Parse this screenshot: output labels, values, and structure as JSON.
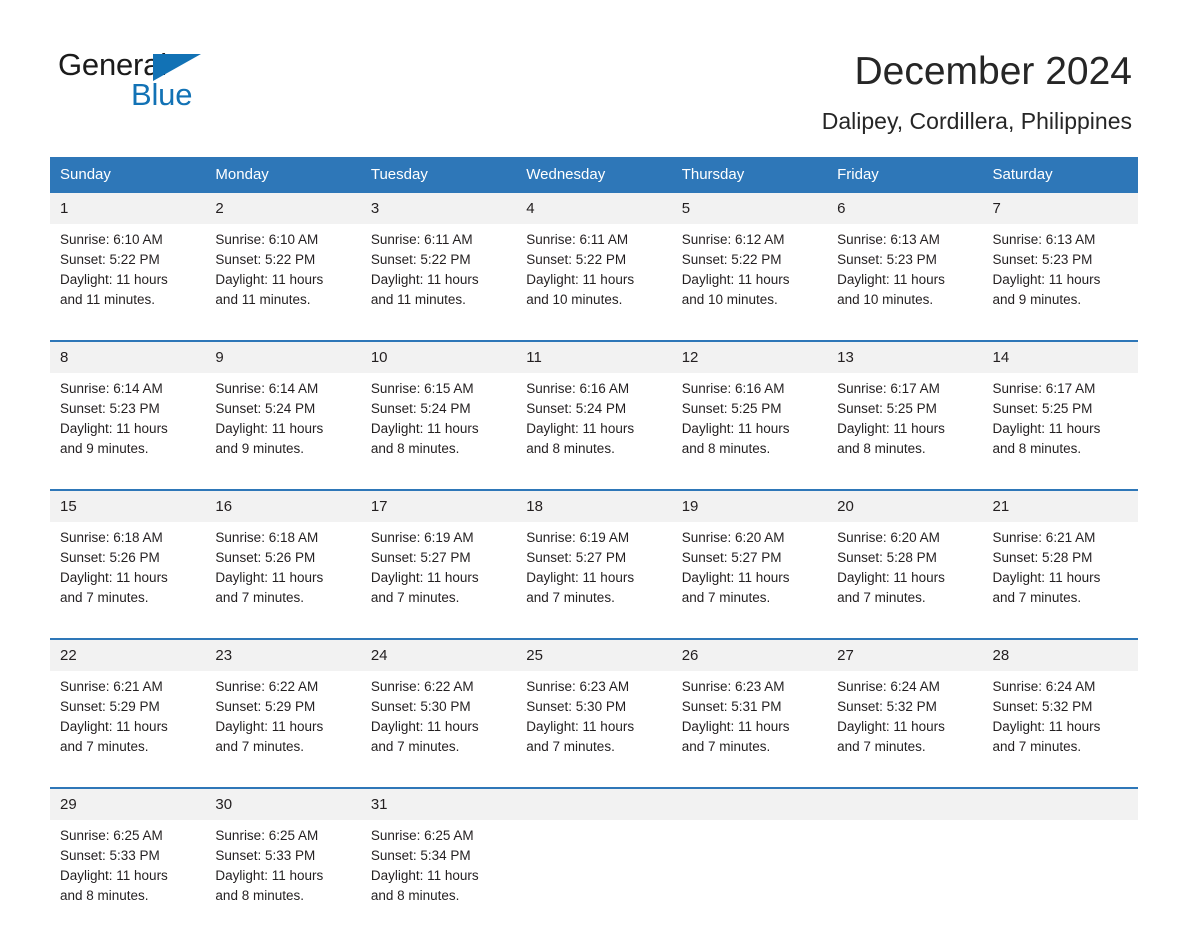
{
  "brand": {
    "name_part1": "General",
    "name_part2": "Blue",
    "triangle_color": "#1272b5",
    "accent_color": "#2e77b8"
  },
  "header": {
    "title": "December 2024",
    "subtitle": "Dalipey, Cordillera, Philippines"
  },
  "calendar": {
    "weekday_headers": [
      "Sunday",
      "Monday",
      "Tuesday",
      "Wednesday",
      "Thursday",
      "Friday",
      "Saturday"
    ],
    "weeks": [
      [
        {
          "day": "1",
          "sunrise": "Sunrise: 6:10 AM",
          "sunset": "Sunset: 5:22 PM",
          "daylight_line1": "Daylight: 11 hours",
          "daylight_line2": "and 11 minutes."
        },
        {
          "day": "2",
          "sunrise": "Sunrise: 6:10 AM",
          "sunset": "Sunset: 5:22 PM",
          "daylight_line1": "Daylight: 11 hours",
          "daylight_line2": "and 11 minutes."
        },
        {
          "day": "3",
          "sunrise": "Sunrise: 6:11 AM",
          "sunset": "Sunset: 5:22 PM",
          "daylight_line1": "Daylight: 11 hours",
          "daylight_line2": "and 11 minutes."
        },
        {
          "day": "4",
          "sunrise": "Sunrise: 6:11 AM",
          "sunset": "Sunset: 5:22 PM",
          "daylight_line1": "Daylight: 11 hours",
          "daylight_line2": "and 10 minutes."
        },
        {
          "day": "5",
          "sunrise": "Sunrise: 6:12 AM",
          "sunset": "Sunset: 5:22 PM",
          "daylight_line1": "Daylight: 11 hours",
          "daylight_line2": "and 10 minutes."
        },
        {
          "day": "6",
          "sunrise": "Sunrise: 6:13 AM",
          "sunset": "Sunset: 5:23 PM",
          "daylight_line1": "Daylight: 11 hours",
          "daylight_line2": "and 10 minutes."
        },
        {
          "day": "7",
          "sunrise": "Sunrise: 6:13 AM",
          "sunset": "Sunset: 5:23 PM",
          "daylight_line1": "Daylight: 11 hours",
          "daylight_line2": "and 9 minutes."
        }
      ],
      [
        {
          "day": "8",
          "sunrise": "Sunrise: 6:14 AM",
          "sunset": "Sunset: 5:23 PM",
          "daylight_line1": "Daylight: 11 hours",
          "daylight_line2": "and 9 minutes."
        },
        {
          "day": "9",
          "sunrise": "Sunrise: 6:14 AM",
          "sunset": "Sunset: 5:24 PM",
          "daylight_line1": "Daylight: 11 hours",
          "daylight_line2": "and 9 minutes."
        },
        {
          "day": "10",
          "sunrise": "Sunrise: 6:15 AM",
          "sunset": "Sunset: 5:24 PM",
          "daylight_line1": "Daylight: 11 hours",
          "daylight_line2": "and 8 minutes."
        },
        {
          "day": "11",
          "sunrise": "Sunrise: 6:16 AM",
          "sunset": "Sunset: 5:24 PM",
          "daylight_line1": "Daylight: 11 hours",
          "daylight_line2": "and 8 minutes."
        },
        {
          "day": "12",
          "sunrise": "Sunrise: 6:16 AM",
          "sunset": "Sunset: 5:25 PM",
          "daylight_line1": "Daylight: 11 hours",
          "daylight_line2": "and 8 minutes."
        },
        {
          "day": "13",
          "sunrise": "Sunrise: 6:17 AM",
          "sunset": "Sunset: 5:25 PM",
          "daylight_line1": "Daylight: 11 hours",
          "daylight_line2": "and 8 minutes."
        },
        {
          "day": "14",
          "sunrise": "Sunrise: 6:17 AM",
          "sunset": "Sunset: 5:25 PM",
          "daylight_line1": "Daylight: 11 hours",
          "daylight_line2": "and 8 minutes."
        }
      ],
      [
        {
          "day": "15",
          "sunrise": "Sunrise: 6:18 AM",
          "sunset": "Sunset: 5:26 PM",
          "daylight_line1": "Daylight: 11 hours",
          "daylight_line2": "and 7 minutes."
        },
        {
          "day": "16",
          "sunrise": "Sunrise: 6:18 AM",
          "sunset": "Sunset: 5:26 PM",
          "daylight_line1": "Daylight: 11 hours",
          "daylight_line2": "and 7 minutes."
        },
        {
          "day": "17",
          "sunrise": "Sunrise: 6:19 AM",
          "sunset": "Sunset: 5:27 PM",
          "daylight_line1": "Daylight: 11 hours",
          "daylight_line2": "and 7 minutes."
        },
        {
          "day": "18",
          "sunrise": "Sunrise: 6:19 AM",
          "sunset": "Sunset: 5:27 PM",
          "daylight_line1": "Daylight: 11 hours",
          "daylight_line2": "and 7 minutes."
        },
        {
          "day": "19",
          "sunrise": "Sunrise: 6:20 AM",
          "sunset": "Sunset: 5:27 PM",
          "daylight_line1": "Daylight: 11 hours",
          "daylight_line2": "and 7 minutes."
        },
        {
          "day": "20",
          "sunrise": "Sunrise: 6:20 AM",
          "sunset": "Sunset: 5:28 PM",
          "daylight_line1": "Daylight: 11 hours",
          "daylight_line2": "and 7 minutes."
        },
        {
          "day": "21",
          "sunrise": "Sunrise: 6:21 AM",
          "sunset": "Sunset: 5:28 PM",
          "daylight_line1": "Daylight: 11 hours",
          "daylight_line2": "and 7 minutes."
        }
      ],
      [
        {
          "day": "22",
          "sunrise": "Sunrise: 6:21 AM",
          "sunset": "Sunset: 5:29 PM",
          "daylight_line1": "Daylight: 11 hours",
          "daylight_line2": "and 7 minutes."
        },
        {
          "day": "23",
          "sunrise": "Sunrise: 6:22 AM",
          "sunset": "Sunset: 5:29 PM",
          "daylight_line1": "Daylight: 11 hours",
          "daylight_line2": "and 7 minutes."
        },
        {
          "day": "24",
          "sunrise": "Sunrise: 6:22 AM",
          "sunset": "Sunset: 5:30 PM",
          "daylight_line1": "Daylight: 11 hours",
          "daylight_line2": "and 7 minutes."
        },
        {
          "day": "25",
          "sunrise": "Sunrise: 6:23 AM",
          "sunset": "Sunset: 5:30 PM",
          "daylight_line1": "Daylight: 11 hours",
          "daylight_line2": "and 7 minutes."
        },
        {
          "day": "26",
          "sunrise": "Sunrise: 6:23 AM",
          "sunset": "Sunset: 5:31 PM",
          "daylight_line1": "Daylight: 11 hours",
          "daylight_line2": "and 7 minutes."
        },
        {
          "day": "27",
          "sunrise": "Sunrise: 6:24 AM",
          "sunset": "Sunset: 5:32 PM",
          "daylight_line1": "Daylight: 11 hours",
          "daylight_line2": "and 7 minutes."
        },
        {
          "day": "28",
          "sunrise": "Sunrise: 6:24 AM",
          "sunset": "Sunset: 5:32 PM",
          "daylight_line1": "Daylight: 11 hours",
          "daylight_line2": "and 7 minutes."
        }
      ],
      [
        {
          "day": "29",
          "sunrise": "Sunrise: 6:25 AM",
          "sunset": "Sunset: 5:33 PM",
          "daylight_line1": "Daylight: 11 hours",
          "daylight_line2": "and 8 minutes."
        },
        {
          "day": "30",
          "sunrise": "Sunrise: 6:25 AM",
          "sunset": "Sunset: 5:33 PM",
          "daylight_line1": "Daylight: 11 hours",
          "daylight_line2": "and 8 minutes."
        },
        {
          "day": "31",
          "sunrise": "Sunrise: 6:25 AM",
          "sunset": "Sunset: 5:34 PM",
          "daylight_line1": "Daylight: 11 hours",
          "daylight_line2": "and 8 minutes."
        },
        {
          "day": "",
          "sunrise": "",
          "sunset": "",
          "daylight_line1": "",
          "daylight_line2": ""
        },
        {
          "day": "",
          "sunrise": "",
          "sunset": "",
          "daylight_line1": "",
          "daylight_line2": ""
        },
        {
          "day": "",
          "sunrise": "",
          "sunset": "",
          "daylight_line1": "",
          "daylight_line2": ""
        },
        {
          "day": "",
          "sunrise": "",
          "sunset": "",
          "daylight_line1": "",
          "daylight_line2": ""
        }
      ]
    ]
  }
}
